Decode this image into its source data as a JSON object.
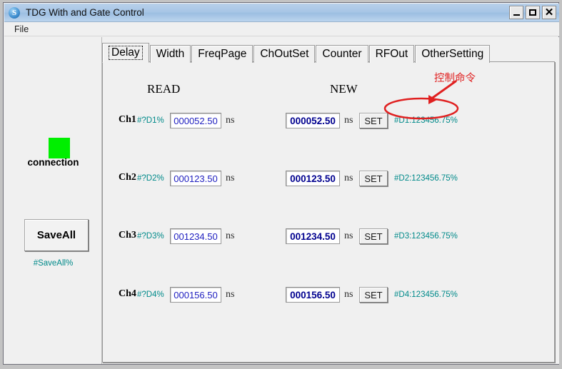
{
  "window": {
    "title": "TDG With and Gate Control",
    "icon": "app-s-icon",
    "icon_glyph": "S",
    "buttons": {
      "minimize": "minimize-icon",
      "maximize": "maximize-icon",
      "close": "close-icon"
    }
  },
  "menubar": {
    "items": [
      {
        "label": "File"
      }
    ]
  },
  "left_panel": {
    "connection": {
      "label": "connection",
      "led_color": "#00ef00",
      "state": "connected"
    },
    "save_all": {
      "button_label": "SaveAll",
      "command": "#SaveAll%"
    }
  },
  "tabs": [
    {
      "label": "Delay",
      "selected": true
    },
    {
      "label": "Width",
      "selected": false
    },
    {
      "label": "FreqPage",
      "selected": false
    },
    {
      "label": "ChOutSet",
      "selected": false
    },
    {
      "label": "Counter",
      "selected": false
    },
    {
      "label": "RFOut",
      "selected": false
    },
    {
      "label": "OtherSetting",
      "selected": false
    }
  ],
  "delay_panel": {
    "headings": {
      "read": "READ",
      "new": "NEW"
    },
    "unit": "ns",
    "set_label": "SET",
    "rows": [
      {
        "channel": "Ch1",
        "read_command": "#?D1%",
        "read_value": "000052.50",
        "new_value": "000052.50",
        "new_command": "#D1:123456.75%"
      },
      {
        "channel": "Ch2",
        "read_command": "#?D2%",
        "read_value": "000123.50",
        "new_value": "000123.50",
        "new_command": "#D2:123456.75%"
      },
      {
        "channel": "Ch3",
        "read_command": "#?D3%",
        "read_value": "001234.50",
        "new_value": "001234.50",
        "new_command": "#D3:123456.75%"
      },
      {
        "channel": "Ch4",
        "read_command": "#?D4%",
        "read_value": "000156.50",
        "new_value": "000156.50",
        "new_command": "#D4:123456.75%"
      }
    ]
  },
  "annotation": {
    "text": "控制命令",
    "color": "#e02020",
    "target": "#D1:123456.75%"
  },
  "colors": {
    "command_text": "#008a8a",
    "read_value_text": "#2020c0",
    "new_value_text": "#00008f",
    "annotation": "#e02020",
    "led": "#00ef00",
    "window_bg": "#f0f0f0"
  }
}
